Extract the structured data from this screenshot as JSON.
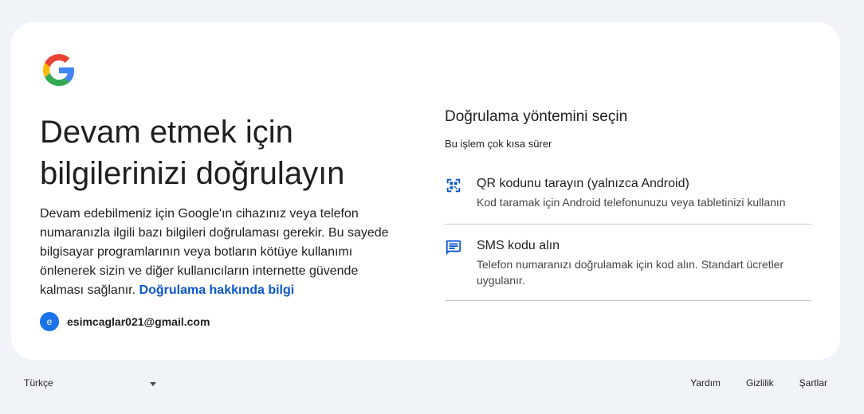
{
  "headline": "Devam etmek için bilgilerinizi doğrulayın",
  "description": "Devam edebilmeniz için Google'ın cihazınız veya telefon numaranızla ilgili bazı bilgileri doğrulaması gerekir. Bu sayede bilgisayar programlarının veya botların kötüye kullanımı önlenerek sizin ve diğer kullanıcıların internette güvende kalması sağlanır.",
  "learn_more_link": "Doğrulama hakkında bilgi",
  "account": {
    "avatar_letter": "e",
    "email": "esimcaglar021@gmail.com"
  },
  "verify": {
    "title": "Doğrulama yöntemini seçin",
    "subtitle": "Bu işlem çok kısa sürer",
    "options": [
      {
        "icon": "qr-code-icon",
        "title": "QR kodunu tarayın (yalnızca Android)",
        "description": "Kod taramak için Android telefonunuzu veya tabletinizi kullanın"
      },
      {
        "icon": "sms-icon",
        "title": "SMS kodu alın",
        "description": "Telefon numaranızı doğrulamak için kod alın. Standart ücretler uygulanır."
      }
    ]
  },
  "footer": {
    "language": "Türkçe",
    "links": [
      "Yardım",
      "Gizlilik",
      "Şartlar"
    ]
  },
  "colors": {
    "accent": "#0b57d0",
    "background": "#f0f4f9",
    "card": "#ffffff",
    "icon_blue": "#0b57d0"
  }
}
